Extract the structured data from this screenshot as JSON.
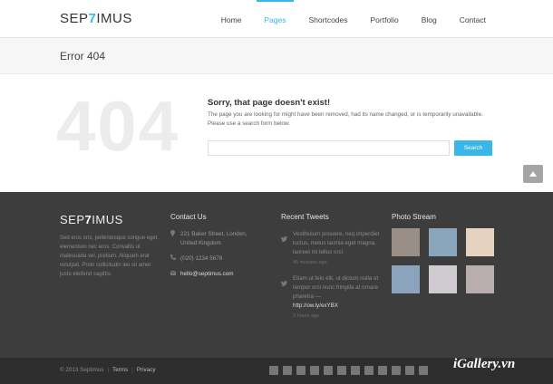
{
  "header": {
    "logo_prefix": "SEP",
    "logo_accent": "7",
    "logo_suffix": "IMUS",
    "nav": [
      "Home",
      "Pages",
      "Shortcodes",
      "Portfolio",
      "Blog",
      "Contact"
    ],
    "active_nav": "Pages"
  },
  "titlebar": {
    "title": "Error 404"
  },
  "error": {
    "big_number": "404",
    "heading": "Sorry, that page doesn't exist!",
    "text": "The page you are looking for might have been removed, had its name changed, or is temporarily unavailable. Please use a search form below.",
    "search_value": "",
    "search_button": "Search"
  },
  "footer": {
    "logo_prefix": "SEP",
    "logo_accent": "7",
    "logo_suffix": "IMUS",
    "about": "Sed eros orci, pellentesque congue eget, elementum nec eros. Convallis ut malesuada vel, pretium. Aliquam erat volutpat. Proin sollicitudin leo sit amet justo eleifend sagittis.",
    "contact": {
      "title": "Contact Us",
      "address": "221 Baker Street, London, United Kingdom",
      "phone": "(020) 1234 5678",
      "email": "hello@septimus.com"
    },
    "tweets": {
      "title": "Recent Tweets",
      "items": [
        {
          "text": "Vestibulum posuere, neq imperdiet luctus, metus lacinia eget magna, laoreet mi tellus orci",
          "link": "",
          "time": "45 minutes ago"
        },
        {
          "text": "Etiam ut felo elit, ut dictum nulla et tempor orci nunc fringilla at ornare pharetra —",
          "link": "http://ow.ly/exYBX",
          "time": "2 hours ago"
        }
      ]
    },
    "photos": {
      "title": "Photo Stream",
      "colors": [
        "#9a8f86",
        "#8aa6bd",
        "#e6d3bf",
        "#8ba3bd",
        "#cfcbd0",
        "#b9aeae"
      ]
    }
  },
  "bottombar": {
    "copyright": "© 2013 Septimus",
    "links": [
      "Terms",
      "Privacy"
    ],
    "social": [
      "facebook-icon",
      "twitter-icon",
      "googleplus-icon",
      "linkedin-icon",
      "pinterest-icon",
      "flickr-icon",
      "dribbble-icon",
      "rss-icon",
      "skype-icon",
      "tumblr-icon",
      "youtube-icon",
      "vimeo-icon"
    ]
  },
  "watermark": "iGallery.vn",
  "colors": {
    "accent": "#38b7e8",
    "footer": "#3d3d3d",
    "bottombar": "#2e2e2e"
  }
}
